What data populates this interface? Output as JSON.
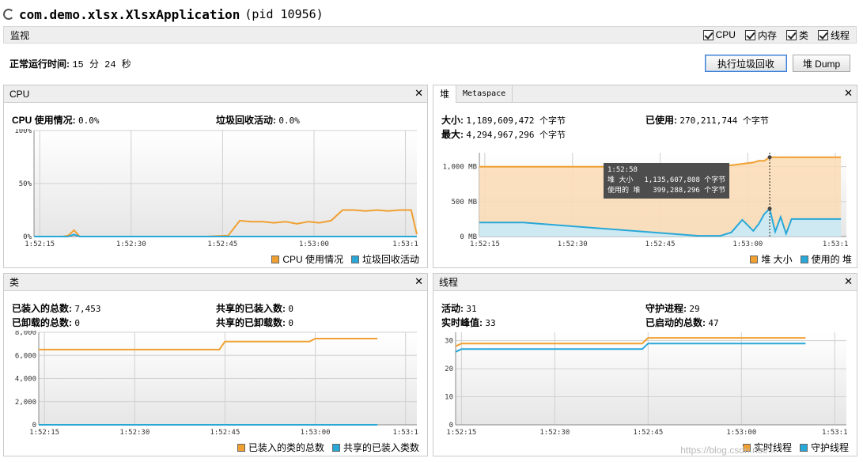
{
  "app": {
    "name": "com.demo.xlsx.XlsxApplication",
    "pid": "(pid 10956)"
  },
  "monitor": {
    "label": "监视",
    "checks": [
      {
        "label": "CPU",
        "checked": true
      },
      {
        "label": "内存",
        "checked": true
      },
      {
        "label": "类",
        "checked": true
      },
      {
        "label": "线程",
        "checked": true
      }
    ]
  },
  "uptime": {
    "label": "正常运行时间:",
    "value": "15 分 24 秒"
  },
  "buttons": {
    "gc": "执行垃圾回收",
    "dump": "堆 Dump"
  },
  "colors": {
    "orange": "#f0a030",
    "blue": "#29a8d8"
  },
  "cpu": {
    "title": "CPU",
    "usage_label": "CPU 使用情况:",
    "usage_value": "0.0%",
    "gc_label": "垃圾回收活动:",
    "gc_value": "0.0%",
    "legend": [
      "CPU 使用情况",
      "垃圾回收活动"
    ]
  },
  "heap": {
    "tabs": [
      "堆",
      "Metaspace"
    ],
    "size_label": "大小:",
    "size_value": "1,189,609,472 个字节",
    "max_label": "最大:",
    "max_value": "4,294,967,296 个字节",
    "used_label": "已使用:",
    "used_value": "270,211,744 个字节",
    "legend": [
      "堆 大小",
      "使用的 堆"
    ],
    "tooltip": {
      "time": "1:52:58",
      "row1_label": "堆 大小",
      "row1_value": "1,135,607,808 个字节",
      "row2_label": "使用的 堆",
      "row2_value": "399,288,296 个字节"
    }
  },
  "classes": {
    "title": "类",
    "loaded_label": "已装入的总数:",
    "loaded_value": "7,453",
    "unloaded_label": "已卸载的总数:",
    "unloaded_value": "0",
    "shared_loaded_label": "共享的已装入数:",
    "shared_loaded_value": "0",
    "shared_unloaded_label": "共享的已卸载数:",
    "shared_unloaded_value": "0",
    "legend": [
      "已装入的类的总数",
      "共享的已装入类数"
    ]
  },
  "threads": {
    "title": "线程",
    "live_label": "活动:",
    "live_value": "31",
    "peak_label": "实时峰值:",
    "peak_value": "33",
    "daemon_label": "守护进程:",
    "daemon_value": "29",
    "started_label": "已启动的总数:",
    "started_value": "47",
    "legend": [
      "实时线程",
      "守护线程"
    ]
  },
  "watermark": "https://blog.csdn.net/...",
  "chart_data": [
    {
      "type": "line",
      "name": "cpu",
      "x_ticks": [
        "1:52:15",
        "1:52:30",
        "1:52:45",
        "1:53:00",
        "1:53:1"
      ],
      "y_ticks": [
        "100%",
        "50%",
        "0%"
      ],
      "ylim": [
        0,
        100
      ],
      "t": [
        0,
        2,
        4,
        6,
        8,
        10,
        12,
        14,
        16,
        18,
        20,
        22,
        24,
        26,
        28,
        30,
        32,
        34,
        36,
        38,
        40,
        42,
        44,
        46,
        48,
        50,
        52,
        54,
        56,
        58,
        60,
        62,
        64,
        66,
        67
      ],
      "series": [
        {
          "name": "CPU 使用情况",
          "values": [
            0,
            0,
            0,
            0,
            0,
            0,
            0,
            6,
            0,
            0,
            0,
            0,
            0,
            0,
            0,
            0,
            0,
            0,
            0,
            0,
            0,
            0,
            0,
            0,
            0,
            0,
            0,
            0,
            0,
            0,
            0,
            0,
            0,
            0,
            0
          ]
        },
        {
          "name": "垃圾回收活动",
          "values": [
            0,
            0,
            0,
            0,
            0,
            0,
            0,
            2,
            0,
            0,
            0,
            0,
            0,
            0,
            0,
            0,
            0,
            0,
            0,
            0,
            0,
            0,
            0,
            0,
            0,
            0,
            0,
            0,
            0,
            0,
            0,
            0,
            0,
            0,
            0
          ]
        }
      ],
      "cpu_later": {
        "t": [
          34,
          36,
          38,
          40,
          42,
          44,
          46,
          48,
          50,
          52,
          54,
          56,
          58,
          60,
          62,
          64,
          66,
          67
        ],
        "values": [
          1,
          15,
          14,
          14,
          13,
          14,
          12,
          14,
          13,
          15,
          25,
          25,
          24,
          25,
          24,
          25,
          25,
          2
        ]
      }
    },
    {
      "type": "area",
      "name": "heap",
      "x_ticks": [
        "1:52:15",
        "1:52:30",
        "1:52:45",
        "1:53:00",
        "1:53:1"
      ],
      "y_ticks": [
        "1,000 MB",
        "500 MB",
        "0 MB"
      ],
      "ylim": [
        0,
        1200
      ],
      "t": [
        0,
        8,
        40,
        44,
        46,
        48,
        50,
        51,
        52,
        53,
        54,
        55,
        56,
        57,
        60,
        66
      ],
      "series": [
        {
          "name": "堆 大小",
          "values": [
            1000,
            1000,
            1000,
            1010,
            1020,
            1040,
            1060,
            1085,
            1085,
            1135,
            1135,
            1135,
            1135,
            1135,
            1135,
            1135
          ]
        },
        {
          "name": "使用的 堆",
          "values": [
            200,
            200,
            10,
            10,
            60,
            240,
            80,
            180,
            320,
            399,
            70,
            280,
            40,
            250,
            250,
            250
          ]
        }
      ]
    },
    {
      "type": "line",
      "name": "classes",
      "x_ticks": [
        "1:52:15",
        "1:52:30",
        "1:52:45",
        "1:53:00",
        "1:53:1"
      ],
      "y_ticks": [
        "8,000",
        "6,000",
        "4,000",
        "2,000",
        "0"
      ],
      "ylim": [
        0,
        8000
      ],
      "t": [
        0,
        32,
        33,
        48,
        49,
        60
      ],
      "series": [
        {
          "name": "已装入的类的总数",
          "values": [
            6500,
            6500,
            7200,
            7200,
            7453,
            7453
          ]
        },
        {
          "name": "共享的已装入类数",
          "values": [
            0,
            0,
            0,
            0,
            0,
            0
          ]
        }
      ]
    },
    {
      "type": "line",
      "name": "threads",
      "x_ticks": [
        "1:52:15",
        "1:52:30",
        "1:52:45",
        "1:53:00",
        "1:53:1"
      ],
      "y_ticks": [
        "30",
        "20",
        "10",
        "0"
      ],
      "ylim": [
        0,
        33
      ],
      "t": [
        0,
        1,
        32,
        33,
        60
      ],
      "series": [
        {
          "name": "实时线程",
          "values": [
            28,
            29,
            29,
            31,
            31
          ]
        },
        {
          "name": "守护线程",
          "values": [
            26,
            27,
            27,
            29,
            29
          ]
        }
      ]
    }
  ]
}
